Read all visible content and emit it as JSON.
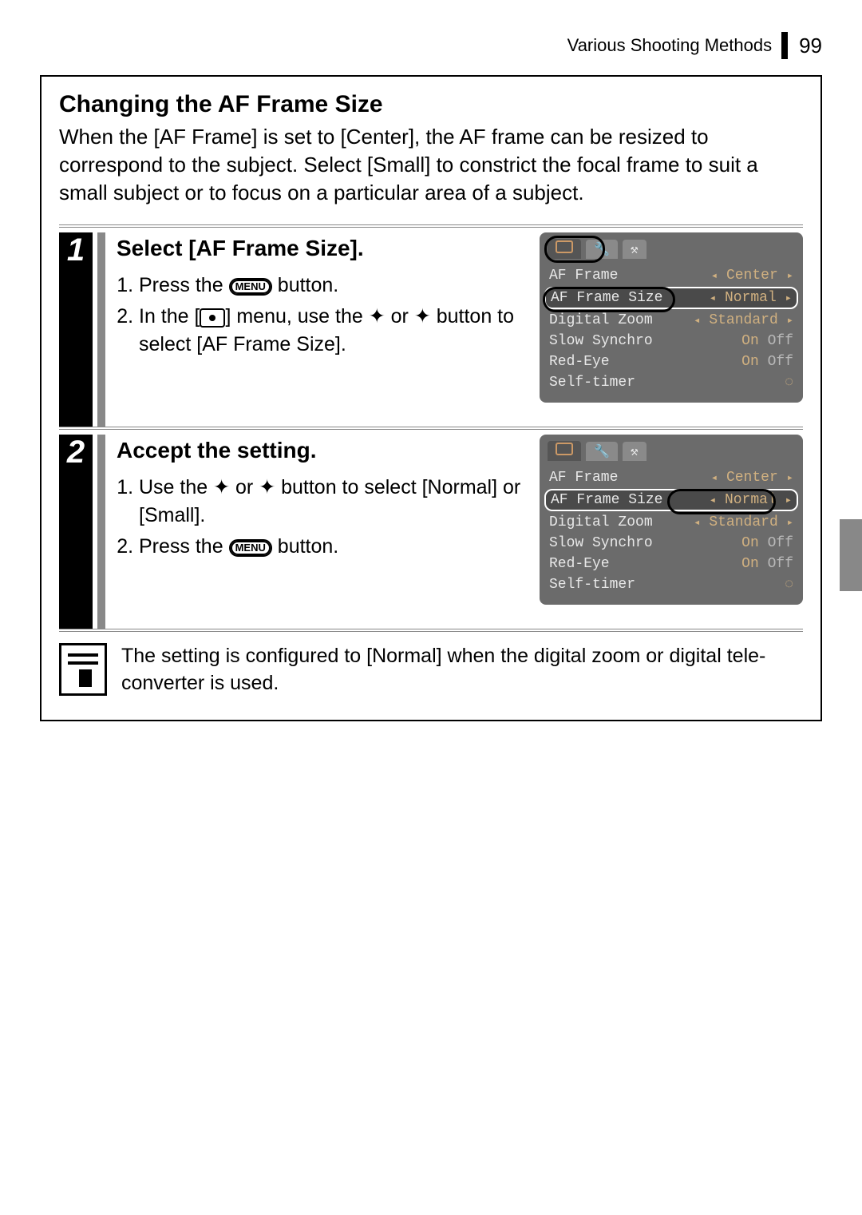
{
  "header": {
    "section": "Various Shooting Methods",
    "page": "99"
  },
  "title": "Changing the AF Frame Size",
  "intro": "When the [AF Frame] is set to [Center], the AF frame can be resized to correspond to the subject. Select [Small] to constrict the focal frame to suit a small subject or to focus on a particular area of a subject.",
  "steps": [
    {
      "num": "1",
      "title": "Select [AF Frame Size].",
      "sub1_a": "Press the ",
      "sub1_b": " button.",
      "sub2_a": "In the [",
      "sub2_b": "] menu, use the ",
      "sub2_c": " or ",
      "sub2_d": " button to select [AF Frame Size].",
      "arrow_up": "✦",
      "arrow_down": "✦"
    },
    {
      "num": "2",
      "title": "Accept the setting.",
      "sub1_a": "Use the ",
      "sub1_b": " or ",
      "sub1_c": " button to select [Normal] or [Small].",
      "sub2_a": "Press the ",
      "sub2_b": " button."
    }
  ],
  "menu_label": "MENU",
  "lcd": {
    "rows": [
      {
        "label": "AF Frame",
        "value": "Center"
      },
      {
        "label": "AF Frame Size",
        "value": "Normal"
      },
      {
        "label": "Digital Zoom",
        "value": "Standard"
      },
      {
        "label": "Slow Synchro",
        "value_on": "On",
        "value_off": "Off"
      },
      {
        "label": "Red-Eye",
        "value_on": "On",
        "value_off": "Off"
      },
      {
        "label": "Self-timer",
        "value": "◌"
      }
    ],
    "tab_tools": "⚒",
    "tab_wrench": "🔧"
  },
  "note": "The setting is configured to [Normal] when the digital zoom or digital tele-converter is used."
}
